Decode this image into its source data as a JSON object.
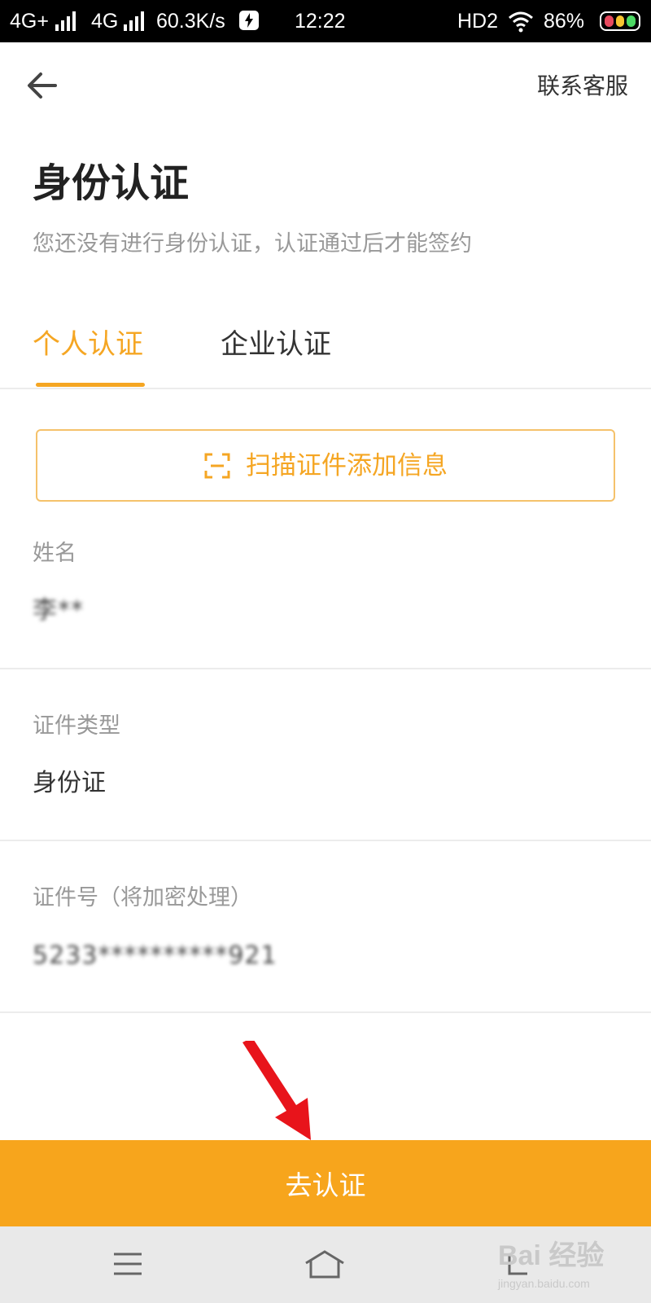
{
  "status_bar": {
    "network1": "4G+",
    "network2": "4G",
    "speed": "60.3K/s",
    "time": "12:22",
    "hd": "HD2",
    "battery": "86%"
  },
  "header": {
    "back_icon": "arrow-left-icon",
    "contact_label": "联系客服"
  },
  "page": {
    "title": "身份认证",
    "subtitle": "您还没有进行身份认证，认证通过后才能签约"
  },
  "tabs": [
    {
      "label": "个人认证",
      "active": true
    },
    {
      "label": "企业认证",
      "active": false
    }
  ],
  "scan_button": {
    "icon": "scan-icon",
    "label": "扫描证件添加信息"
  },
  "fields": {
    "name": {
      "label": "姓名",
      "value": "李**"
    },
    "id_type": {
      "label": "证件类型",
      "value": "身份证"
    },
    "id_number": {
      "label": "证件号（将加密处理）",
      "value": "5233**********921"
    }
  },
  "submit_label": "去认证",
  "watermark": {
    "brand": "Bai 经验",
    "url": "jingyan.baidu.com"
  },
  "colors": {
    "accent": "#f5a623",
    "submit_bg": "#f7a51c",
    "annotation_arrow": "#e8141b"
  }
}
